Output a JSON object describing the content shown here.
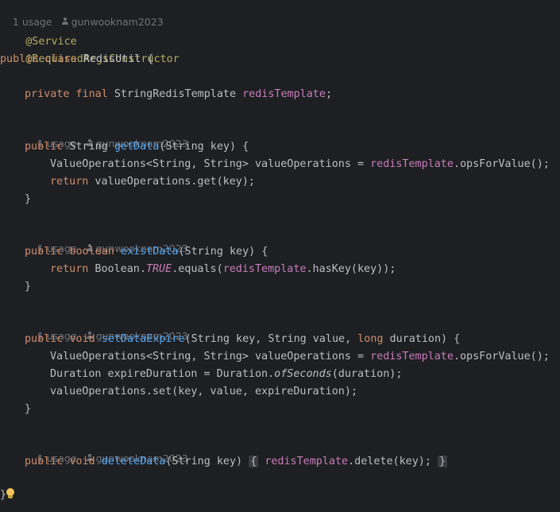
{
  "editor": {
    "class_hint": {
      "usages": "1 usage",
      "author": "gunwooknam2023"
    },
    "annotations": [
      "@Service",
      "@RequiredArgsConstructor"
    ],
    "class_decl": {
      "kw1": "public",
      "kw2": "class",
      "name": "RedisUtil",
      "brace": " {"
    },
    "field": {
      "kw1": "private",
      "kw2": "final",
      "type": "StringRedisTemplate",
      "name": "redisTemplate",
      "end": ";"
    },
    "methods": [
      {
        "hint": {
          "usages": "1 usage",
          "author": "gunwooknam2023"
        },
        "decl": {
          "kw": "public",
          "type": " String ",
          "name": "getData",
          "params": "(String key) {"
        },
        "body": [
          {
            "a": "ValueOperations<String, String> valueOperations = ",
            "f": "redisTemplate",
            "b": ".opsForValue();"
          },
          {
            "kw": "return",
            "rest": " valueOperations.get(key);"
          }
        ],
        "close": "}"
      },
      {
        "hint": {
          "usages": "1 usage",
          "author": "gunwooknam2023"
        },
        "decl": {
          "kw": "public",
          "kw2": "boolean",
          "name": "existData",
          "params": "(String key) {"
        },
        "body": [
          {
            "kw": "return",
            "a": " Boolean.",
            "s": "TRUE",
            "b": ".equals(",
            "f": "redisTemplate",
            "c": ".hasKey(key));"
          }
        ],
        "close": "}"
      },
      {
        "hint": {
          "usages": "1 usage",
          "author": "gunwooknam2023"
        },
        "decl": {
          "kw": "public",
          "kw2": "void",
          "name": "setDataExpire",
          "p1": "(String key, String value, ",
          "pkw": "long",
          "p2": " duration) {"
        },
        "body": [
          {
            "a": "ValueOperations<String, String> valueOperations = ",
            "f": "redisTemplate",
            "b": ".opsForValue();"
          },
          {
            "a": "Duration expireDuration = Duration.",
            "i": "ofSeconds",
            "b": "(duration);"
          },
          {
            "a": "valueOperations.set(key, value, expireDuration);"
          }
        ],
        "close": "}"
      },
      {
        "hint": {
          "usages": "1 usage",
          "author": "gunwooknam2023"
        },
        "decl": {
          "kw": "public",
          "kw2": "void",
          "name": "deleteData",
          "params": "(String key) ",
          "fold_open": "{",
          "f": "redisTemplate",
          "rest": ".delete(key); ",
          "fold_close": "}"
        }
      }
    ],
    "class_close": "}"
  }
}
